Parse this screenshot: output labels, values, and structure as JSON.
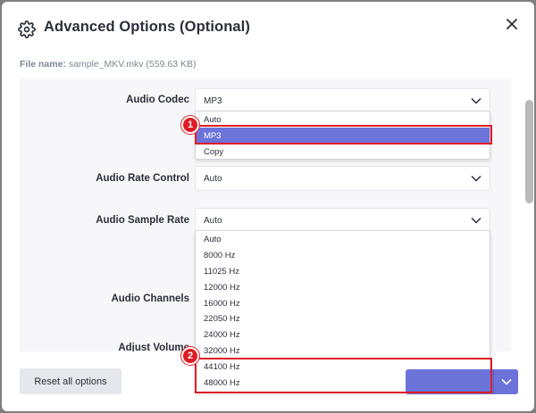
{
  "header": {
    "title": "Advanced Options (Optional)"
  },
  "file": {
    "label": "File name:",
    "value": "sample_MKV.mkv (559.63 KB)"
  },
  "form": {
    "audio_codec": {
      "label": "Audio Codec",
      "value": "MP3",
      "options": [
        "Auto",
        "MP3",
        "Copy"
      ],
      "selected": "MP3"
    },
    "audio_rate_control": {
      "label": "Audio Rate Control",
      "value": "Auto"
    },
    "audio_sample_rate": {
      "label": "Audio Sample Rate",
      "value": "Auto",
      "options": [
        "Auto",
        "8000 Hz",
        "11025 Hz",
        "12000 Hz",
        "16000 Hz",
        "22050 Hz",
        "24000 Hz",
        "32000 Hz",
        "44100 Hz",
        "48000 Hz"
      ]
    },
    "audio_channels": {
      "label": "Audio Channels"
    },
    "adjust_volume": {
      "label": "Adjust Volume"
    }
  },
  "annotations": {
    "badge1": "1",
    "badge2": "2"
  },
  "footer": {
    "reset_label": "Reset all options"
  },
  "colors": {
    "accent": "#6c73d9",
    "highlight": "#e01b24"
  }
}
